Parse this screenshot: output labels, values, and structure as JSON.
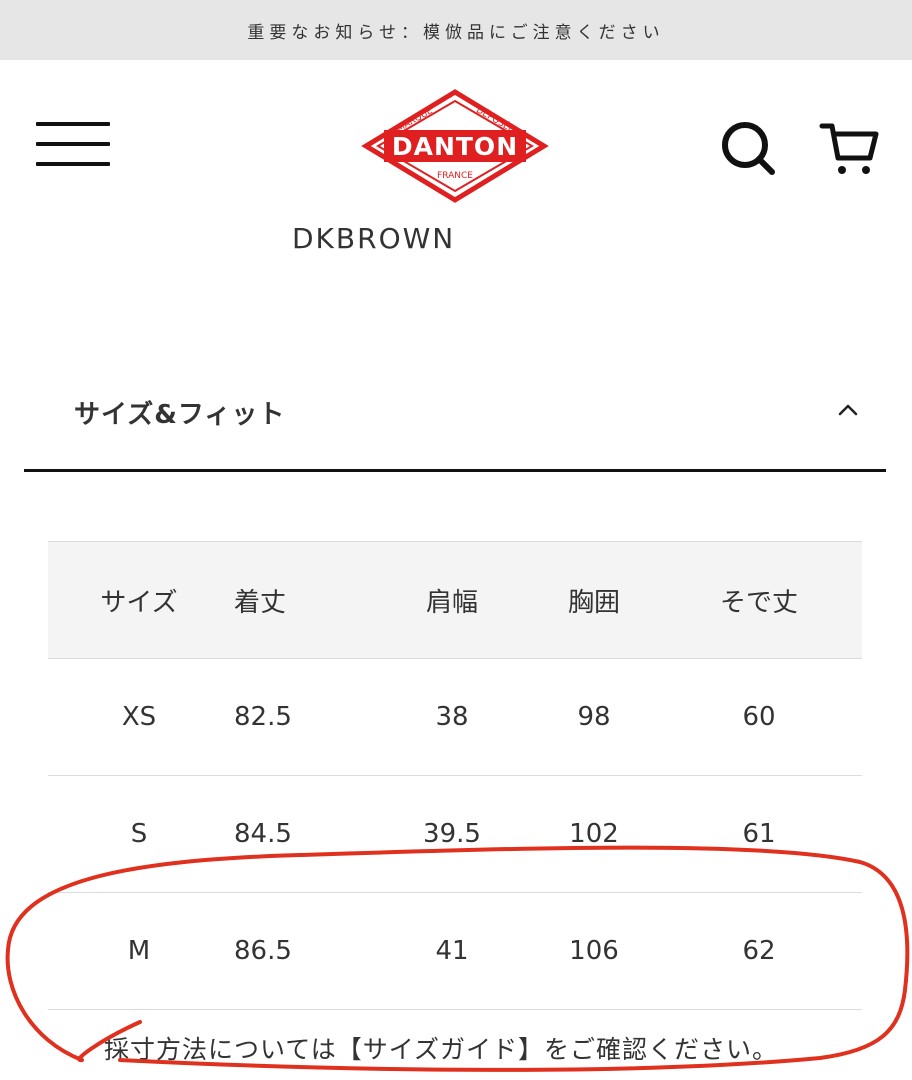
{
  "notice": {
    "text": "重要なお知らせ：模倣品にご注意ください"
  },
  "header": {
    "menu_icon": "hamburger-menu-icon",
    "logo": {
      "name": "DANTON",
      "top_left": "MARQUE",
      "top_right": "DÉPOSÉE",
      "bottom": "FRANCE",
      "color": "#e02020"
    },
    "search_icon": "search-icon",
    "cart_icon": "cart-icon"
  },
  "product": {
    "color_name": "DKBROWN"
  },
  "size_fit": {
    "title": "サイズ&フィット",
    "expanded": true,
    "table": {
      "headers": [
        "サイズ",
        "着丈",
        "肩幅",
        "胸囲",
        "そで丈"
      ],
      "rows": [
        [
          "XS",
          "82.5",
          "38",
          "98",
          "60"
        ],
        [
          "S",
          "84.5",
          "39.5",
          "102",
          "61"
        ],
        [
          "M",
          "86.5",
          "41",
          "106",
          "62"
        ]
      ]
    },
    "footnote": "採寸方法については【サイズガイド】をご確認ください。"
  },
  "colors": {
    "annotation_red": "#e0301e",
    "header_row_bg": "#f4f4f4",
    "notice_bg": "#e6e6e6"
  }
}
